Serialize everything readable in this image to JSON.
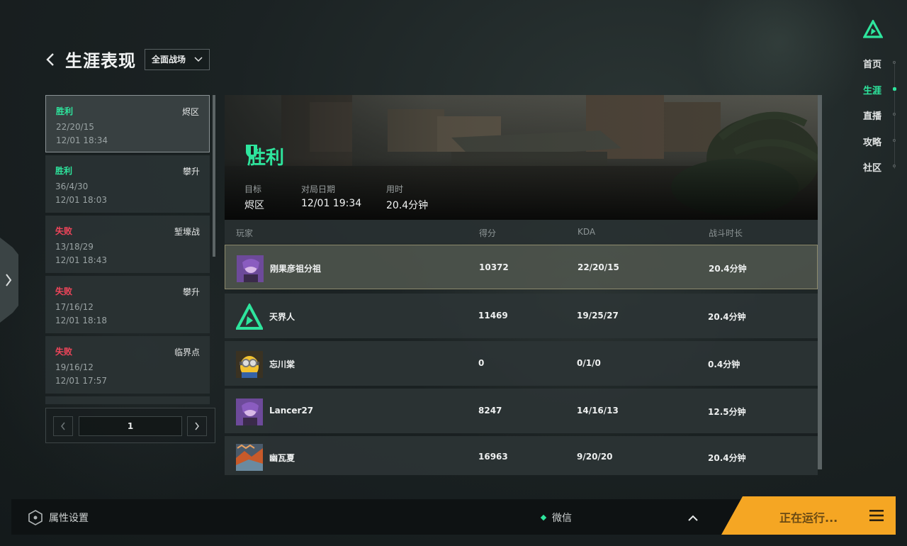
{
  "header": {
    "title": "生涯表现",
    "mode_select": "全面战场"
  },
  "match_list": [
    {
      "result": "胜利",
      "result_type": "win",
      "map": "烬区",
      "kda": "22/20/15",
      "time": "12/01 18:34"
    },
    {
      "result": "胜利",
      "result_type": "win",
      "map": "攀升",
      "kda": "36/4/30",
      "time": "12/01 18:03"
    },
    {
      "result": "失败",
      "result_type": "lose",
      "map": "堑壕战",
      "kda": "13/18/29",
      "time": "12/01 18:43"
    },
    {
      "result": "失败",
      "result_type": "lose",
      "map": "攀升",
      "kda": "17/16/12",
      "time": "12/01 18:18"
    },
    {
      "result": "失败",
      "result_type": "lose",
      "map": "临界点",
      "kda": "19/16/12",
      "time": "12/01 17:57"
    }
  ],
  "pager": {
    "page": "1"
  },
  "detail": {
    "result": "胜利",
    "stats": [
      {
        "label": "目标",
        "value": "烬区"
      },
      {
        "label": "对局日期",
        "value": "12/01 19:34"
      },
      {
        "label": "用时",
        "value": "20.4分钟"
      }
    ],
    "columns": {
      "player": "玩家",
      "score": "得分",
      "kda": "KDA",
      "duration": "战斗时长"
    },
    "players": [
      {
        "name": "刚果彦祖分祖",
        "score": "10372",
        "kda": "22/20/15",
        "duration": "20.4分钟",
        "avatar": "anime-avatar-icon"
      },
      {
        "name": "天界人",
        "score": "11469",
        "kda": "19/25/27",
        "duration": "20.4分钟",
        "avatar": "delta-logo-icon"
      },
      {
        "name": "忘川棠",
        "score": "0",
        "kda": "0/1/0",
        "duration": "0.4分钟",
        "avatar": "minion-avatar-icon"
      },
      {
        "name": "Lancer27",
        "score": "8247",
        "kda": "14/16/13",
        "duration": "12.5分钟",
        "avatar": "anime-avatar-icon"
      },
      {
        "name": "幽瓦夏",
        "score": "16963",
        "kda": "9/20/20",
        "duration": "20.4分钟",
        "avatar": "landscape-avatar-icon"
      }
    ]
  },
  "nav": [
    {
      "label": "首页",
      "active": false
    },
    {
      "label": "生涯",
      "active": true
    },
    {
      "label": "直播",
      "active": false
    },
    {
      "label": "攻略",
      "active": false
    },
    {
      "label": "社区",
      "active": false
    }
  ],
  "bottom": {
    "settings_label": "属性设置",
    "wechat_label": "微信",
    "run_label": "正在运行..."
  },
  "colors": {
    "accent": "#2ee59d",
    "lose": "#f0455a",
    "run_button": "#f5a623"
  }
}
